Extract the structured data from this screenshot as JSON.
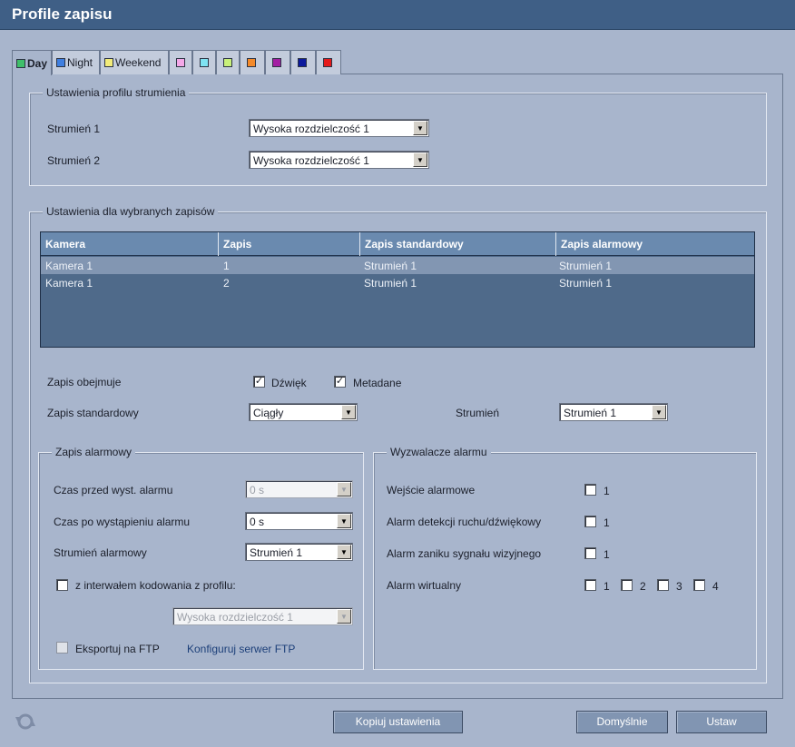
{
  "window": {
    "title": "Profile zapisu"
  },
  "tabs": [
    {
      "label": "Day",
      "color": "#3fbf6a"
    },
    {
      "label": "Night",
      "color": "#3f7fe0"
    },
    {
      "label": "Weekend",
      "color": "#f2ec7a"
    },
    {
      "label": "",
      "color": "#f4a8e8"
    },
    {
      "label": "",
      "color": "#7fe3f2"
    },
    {
      "label": "",
      "color": "#c8f07a"
    },
    {
      "label": "",
      "color": "#f48a2a"
    },
    {
      "label": "",
      "color": "#a31fa3"
    },
    {
      "label": "",
      "color": "#0c1a9c"
    },
    {
      "label": "",
      "color": "#e41a1a"
    }
  ],
  "stream_profile": {
    "legend": "Ustawienia profilu strumienia",
    "stream1_label": "Strumień 1",
    "stream1_value": "Wysoka rozdzielczość 1",
    "stream2_label": "Strumień 2",
    "stream2_value": "Wysoka rozdzielczość 1"
  },
  "selected_recordings": {
    "legend": "Ustawienia dla wybranych zapisów",
    "table": {
      "headers": [
        "Kamera",
        "Zapis",
        "Zapis standardowy",
        "Zapis alarmowy"
      ],
      "rows": [
        [
          "Kamera 1",
          "1",
          "Strumień 1",
          "Strumień 1"
        ],
        [
          "Kamera 1",
          "2",
          "Strumień 1",
          "Strumień 1"
        ]
      ]
    },
    "includes_label": "Zapis obejmuje",
    "audio_label": "Dźwięk",
    "audio_checked": "✓",
    "metadata_label": "Metadane",
    "metadata_checked": "✓",
    "standard_label": "Zapis standardowy",
    "standard_value": "Ciągły",
    "stream_label": "Strumień",
    "stream_value": "Strumień 1"
  },
  "alarm_recording": {
    "legend": "Zapis alarmowy",
    "pre_alarm_label": "Czas przed wyst. alarmu",
    "pre_alarm_value": "0 s",
    "post_alarm_label": "Czas po wystąpieniu alarmu",
    "post_alarm_value": "0 s",
    "alarm_stream_label": "Strumień alarmowy",
    "alarm_stream_value": "Strumień 1",
    "interval_label": "z interwałem kodowania z profilu:",
    "interval_profile_value": "Wysoka rozdzielczość 1",
    "export_ftp_label": "Eksportuj na FTP",
    "configure_ftp_link": "Konfiguruj serwer FTP"
  },
  "alarm_triggers": {
    "legend": "Wyzwalacze alarmu",
    "alarm_input_label": "Wejście alarmowe",
    "motion_label": "Alarm detekcji ruchu/dźwiękowy",
    "video_loss_label": "Alarm zaniku sygnału wizyjnego",
    "virtual_label": "Alarm wirtualny",
    "nums": [
      "1",
      "2",
      "3",
      "4"
    ]
  },
  "footer": {
    "copy_button": "Kopiuj ustawienia",
    "defaults_button": "Domyślnie",
    "set_button": "Ustaw"
  }
}
